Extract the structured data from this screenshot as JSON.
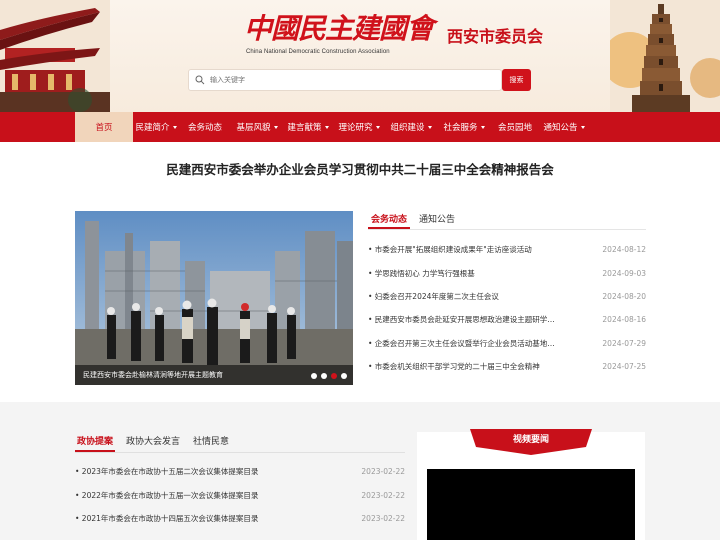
{
  "header": {
    "logo_cn": "中國民主建國會",
    "logo_en": "China National Democratic Construction Association",
    "subtitle": "西安市委员会",
    "search_placeholder": "输入关键字",
    "search_button": "搜索"
  },
  "nav": [
    {
      "label": "首页",
      "active": true,
      "caret": false
    },
    {
      "label": "民建简介",
      "active": false,
      "caret": true
    },
    {
      "label": "会务动态",
      "active": false,
      "caret": false
    },
    {
      "label": "基层风貌",
      "active": false,
      "caret": true
    },
    {
      "label": "建言献策",
      "active": false,
      "caret": true
    },
    {
      "label": "理论研究",
      "active": false,
      "caret": true
    },
    {
      "label": "组织建设",
      "active": false,
      "caret": true
    },
    {
      "label": "社会服务",
      "active": false,
      "caret": true
    },
    {
      "label": "会员园地",
      "active": false,
      "caret": false
    },
    {
      "label": "通知公告",
      "active": false,
      "caret": true
    }
  ],
  "headline": "民建西安市委会举办企业会员学习贯彻中共二十届三中全会精神报告会",
  "slider": {
    "caption": "民建西安市委会赴榆林清涧等地开展主题教育",
    "dots": 4,
    "active_dot": 3
  },
  "news": {
    "tabs": [
      "会务动态",
      "通知公告"
    ],
    "items": [
      {
        "title": "• 市委会开展\"拓展组织建设成果年\"走访座谈活动",
        "date": "2024-08-12"
      },
      {
        "title": "• 学思践悟初心 力学笃行强根基",
        "date": "2024-09-03"
      },
      {
        "title": "• 妇委会召开2024年度第二次主任会议",
        "date": "2024-08-20"
      },
      {
        "title": "• 民建西安市委员会赴延安开展思想政治建设主题研学…",
        "date": "2024-08-16"
      },
      {
        "title": "• 企委会召开第三次主任会议暨举行企业会员活动基地…",
        "date": "2024-07-29"
      },
      {
        "title": "• 市委会机关组织干部学习党的二十届三中全会精神",
        "date": "2024-07-25"
      }
    ]
  },
  "proposals": {
    "tabs": [
      "政协提案",
      "政协大会发言",
      "社情民意"
    ],
    "items": [
      {
        "title": "• 2023年市委会在市政协十五届二次会议集体提案目录",
        "date": "2023-02-22"
      },
      {
        "title": "• 2022年市委会在市政协十五届一次会议集体提案目录",
        "date": "2023-02-22"
      },
      {
        "title": "• 2021年市委会在市政协十四届五次会议集体提案目录",
        "date": "2023-02-22"
      }
    ]
  },
  "video": {
    "title": "视频要闻"
  },
  "colors": {
    "brand_red": "#c8101a",
    "nav_active_bg": "#f1d5bb"
  }
}
